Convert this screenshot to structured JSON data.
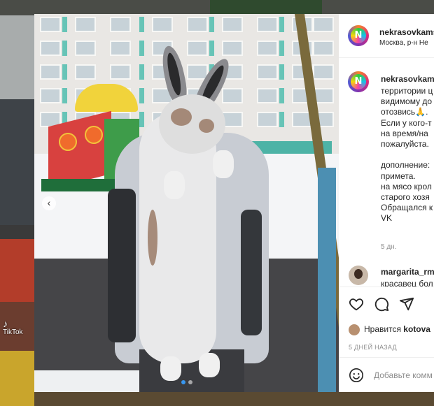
{
  "backdrop": {
    "tiktok_watermark": "TikTok"
  },
  "post": {
    "image_nav_left": "‹",
    "carousel": {
      "current_index": 1,
      "total": 2
    }
  },
  "header": {
    "username": "nekrasovkams",
    "location": "Москва, р-н Не",
    "avatar_letter": "N"
  },
  "caption": {
    "username": "nekrasovkam",
    "lines": [
      "территории ц",
      "видимому до",
      "отозвись🙏.",
      "Если у кого-т",
      "на время/на",
      "пожалуйста.",
      "",
      "дополнение:",
      "примета.",
      "на мясо крол",
      "старого хозя",
      "Обращался к",
      "VK"
    ],
    "time_ago": "5 дн."
  },
  "comment": {
    "username": "margarita_rm",
    "text": "красавец бол"
  },
  "actions": {
    "like_icon": "heart-icon",
    "comment_icon": "comment-icon",
    "share_icon": "share-icon",
    "likes_prefix": "Нравится",
    "likes_user": "kotova",
    "date": "5 ДНЕЙ НАЗАД"
  },
  "comment_input": {
    "placeholder": "Добавьте комм",
    "emoji_icon": "emoji-icon"
  },
  "colors": {
    "link_blue": "#3897f0",
    "muted": "#8e8e8e",
    "text": "#262626",
    "border": "#efefef"
  }
}
